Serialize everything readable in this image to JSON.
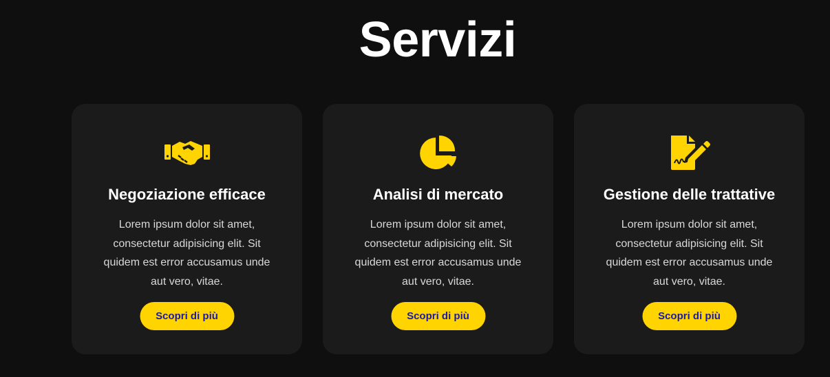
{
  "section": {
    "title": "Servizi"
  },
  "colors": {
    "background": "#0f0f10",
    "card": "#1b1b1c",
    "accent": "#ffd400",
    "button_text": "#1a1aa8"
  },
  "cards": [
    {
      "icon": "handshake-icon",
      "title": "Negoziazione efficace",
      "text": "Lorem ipsum dolor sit amet, consectetur adipisicing elit. Sit quidem est error accusamus unde aut vero, vitae.",
      "button": "Scopri di più"
    },
    {
      "icon": "pie-chart-icon",
      "title": "Analisi di mercato",
      "text": "Lorem ipsum dolor sit amet, consectetur adipisicing elit. Sit quidem est error accusamus unde aut vero, vitae.",
      "button": "Scopri di più"
    },
    {
      "icon": "file-signature-icon",
      "title": "Gestione delle trattative",
      "text": "Lorem ipsum dolor sit amet, consectetur adipisicing elit. Sit quidem est error accusamus unde aut vero, vitae.",
      "button": "Scopri di più"
    }
  ]
}
